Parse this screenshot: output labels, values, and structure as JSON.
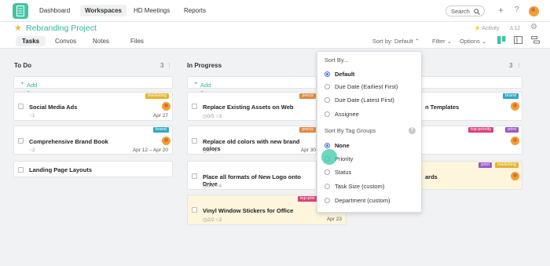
{
  "nav": {
    "items": [
      "Dashboard",
      "Workspaces",
      "HD Meetings",
      "Reports"
    ],
    "search_label": "Search",
    "plus_icon": "+",
    "help_icon": "?"
  },
  "project": {
    "title": "Rebranding Project",
    "activity": "Activity",
    "members": "12",
    "tabs": [
      "Tasks",
      "Convos",
      "Notes",
      "Files"
    ],
    "sort_label": "Sort by: Default",
    "filter_label": "Filter",
    "options_label": "Options"
  },
  "columns": [
    {
      "name": "To Do",
      "count": "3",
      "add_label": "Add a Task",
      "cards": [
        {
          "title": "Social Media Ads",
          "meta": "1",
          "date": "Apr 27",
          "tag": "marketing"
        },
        {
          "title": "Comprehensive Brand Book",
          "meta": "2",
          "date": "Apr 12 – Apr 20",
          "tag": "brand"
        },
        {
          "title": "Landing Page Layouts",
          "meta": "",
          "date": "",
          "tag": ""
        }
      ]
    },
    {
      "name": "In Progress",
      "count": "",
      "add_label": "Add a Task",
      "cards": [
        {
          "title": "Replace Existing Assets on Web",
          "meta1": "0/5",
          "meta2": "3",
          "date": "",
          "tag": "precis"
        },
        {
          "title": "Replace old colors with new brand colors",
          "meta1": "0",
          "meta2": "2",
          "date": "Apr 30",
          "tag": "precis"
        },
        {
          "title": "Place all formats of New Logo onto Drive",
          "meta1": "0/4",
          "meta2": "4",
          "date": "",
          "tag": ""
        },
        {
          "title": "Vinyl Window Stickers for Office",
          "meta1": "2/2",
          "meta2": "3",
          "date": "Apr 23",
          "tag": "top-prio"
        }
      ]
    },
    {
      "name": "",
      "count": "3",
      "cards": [
        {
          "title": "n Templates",
          "tag": "brand"
        },
        {
          "title": "",
          "tags": [
            "top-priority",
            "print"
          ]
        },
        {
          "title": "ards",
          "tags": [
            "print",
            "marketing"
          ]
        }
      ]
    }
  ],
  "sort_menu": {
    "sort_by_title": "Sort By...",
    "sort_options": [
      "Default",
      "Due Date (Earliest First)",
      "Due Date (Latest First)",
      "Assignee"
    ],
    "group_title": "Sort By Tag Groups",
    "group_options": [
      "None",
      "Priority",
      "Status",
      "Task Size (custom)",
      "Department (custom)"
    ],
    "help": "?"
  },
  "colors": {
    "accent": "#3fc4a4",
    "marketing_tag": "#e3b52e",
    "brand_tag": "#2fa7c9",
    "precis_tag": "#e0883c",
    "top_priority_tag": "#d9427a",
    "print_tag": "#9b59c5"
  }
}
